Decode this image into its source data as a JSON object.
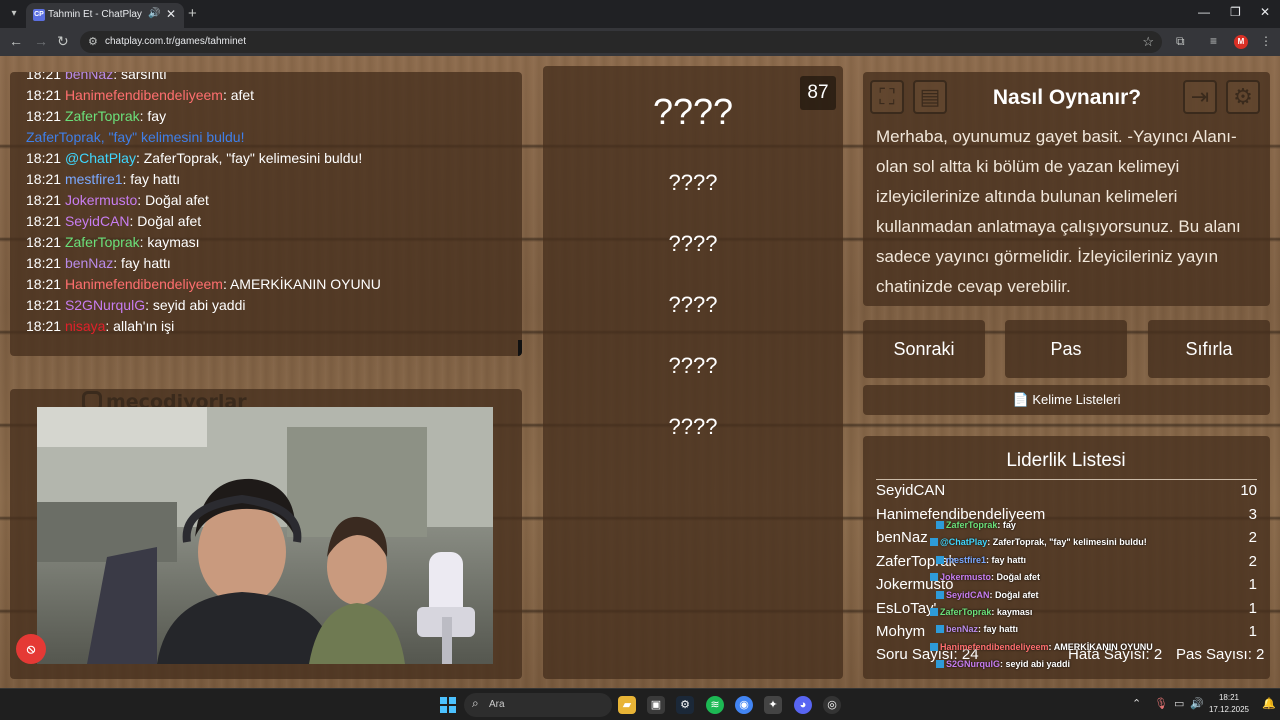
{
  "browser": {
    "tab_title": "Tahmin Et - ChatPlay",
    "favicon_text": "CP",
    "url": "chatplay.com.tr/games/tahminet",
    "profile_initial": "M"
  },
  "chat": {
    "lines": [
      {
        "time": "18:21",
        "user": "benNaz",
        "color": "#b98be8",
        "text": ": sarsıntı"
      },
      {
        "time": "18:21",
        "user": "Hanimefendibendeliyeem",
        "color": "#ff6f6f",
        "text": ": afet"
      },
      {
        "time": "18:21",
        "user": "ZaferToprak",
        "color": "#6be07a",
        "text": ": fay"
      },
      {
        "time": "",
        "user": "ZaferToprak, \"fay\" kelimesini buldu!",
        "color": "#3f7fe8",
        "text": ""
      },
      {
        "time": "18:21",
        "user": "@ChatPlay",
        "color": "#3fd7ff",
        "text": ": ZaferToprak, \"fay\" kelimesini buldu!"
      },
      {
        "time": "18:21",
        "user": "mestfire1",
        "color": "#7aa8ff",
        "text": ": fay hattı"
      },
      {
        "time": "18:21",
        "user": "Jokermusto",
        "color": "#c77df0",
        "text": ": Doğal afet"
      },
      {
        "time": "18:21",
        "user": "SeyidCAN",
        "color": "#c77df0",
        "text": ": Doğal afet"
      },
      {
        "time": "18:21",
        "user": "ZaferToprak",
        "color": "#6be07a",
        "text": ": kayması"
      },
      {
        "time": "18:21",
        "user": "benNaz",
        "color": "#b98be8",
        "text": ": fay hattı"
      },
      {
        "time": "18:21",
        "user": "Hanimefendibendeliyeem",
        "color": "#ff6f6f",
        "text": ": AMERKİKANIN OYUNU"
      },
      {
        "time": "18:21",
        "user": "S2GNurqulG",
        "color": "#c77df0",
        "text": ": seyid abi yaddi"
      },
      {
        "time": "18:21",
        "user": "nisaya",
        "color": "#e0202a",
        "text": ": allah'ın işi"
      }
    ]
  },
  "cam": {
    "instagram_handle": "mecodiyorlar"
  },
  "game": {
    "remaining": "87",
    "main_word": "????",
    "forbidden_words": [
      "????",
      "????",
      "????",
      "????",
      "????"
    ]
  },
  "howto": {
    "title": "Nasıl Oynanır?",
    "description": "Merhaba, oyunumuz gayet basit. -Yayıncı Alanı- olan sol altta ki bölüm de yazan kelimeyi izleyicilerinize altında bulunan kelimeleri kullanmadan anlatmaya çalışıyorsunuz. Bu alanı sadece yayıncı görmelidir. İzleyicileriniz yayın chatinizde cevap verebilir."
  },
  "actions": {
    "next": "Sonraki",
    "pass": "Pas",
    "reset": "Sıfırla",
    "word_lists": "Kelime Listeleri"
  },
  "leaderboard": {
    "title": "Liderlik Listesi",
    "rows": [
      {
        "name": "SeyidCAN",
        "score": "10"
      },
      {
        "name": "Hanimefendibendeliyeem",
        "score": "3"
      },
      {
        "name": "benNaz",
        "score": "2"
      },
      {
        "name": "ZaferToprak",
        "score": "2"
      },
      {
        "name": "Jokermusto",
        "score": "1"
      },
      {
        "name": "EsLoTay'",
        "score": "1"
      },
      {
        "name": "Mohym",
        "score": "1"
      }
    ],
    "question_count": "Soru Sayısı: 24",
    "error_count": "Hata Sayısı: 2",
    "pass_count": "Pas Sayısı: 2"
  },
  "overlay_chat": [
    {
      "user": "ZaferToprak",
      "color": "#6be07a",
      "text": ": fay"
    },
    {
      "user": "@ChatPlay",
      "color": "#3fd7ff",
      "text": ": ZaferToprak, \"fay\" kelimesini buldu!"
    },
    {
      "user": "mestfire1",
      "color": "#7aa8ff",
      "text": ": fay hattı"
    },
    {
      "user": "Jokermusto",
      "color": "#c77df0",
      "text": ": Doğal afet"
    },
    {
      "user": "SeyidCAN",
      "color": "#c77df0",
      "text": ": Doğal afet"
    },
    {
      "user": "ZaferToprak",
      "color": "#6be07a",
      "text": ": kayması"
    },
    {
      "user": "benNaz",
      "color": "#b98be8",
      "text": ": fay hattı"
    },
    {
      "user": "Hanimefendibendeliyeem",
      "color": "#ff6f6f",
      "text": ": AMERKİKANIN OYUNU"
    },
    {
      "user": "S2GNurqulG",
      "color": "#c77df0",
      "text": ": seyid abi yaddi"
    }
  ],
  "taskbar": {
    "search_placeholder": "Ara",
    "time": "18:21",
    "date": "17.12.2025"
  }
}
